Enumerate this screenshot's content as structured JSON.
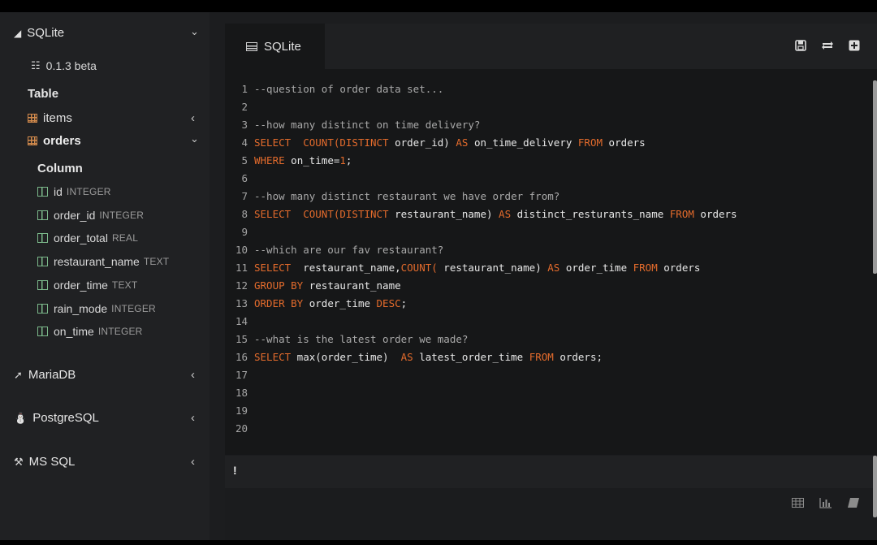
{
  "sidebar": {
    "sqlite": {
      "title": "SQLite",
      "version": "0.1.3 beta"
    },
    "table_heading": "Table",
    "tables": [
      {
        "name": "items"
      },
      {
        "name": "orders"
      }
    ],
    "column_heading": "Column",
    "columns": [
      {
        "name": "id",
        "type": "INTEGER"
      },
      {
        "name": "order_id",
        "type": "INTEGER"
      },
      {
        "name": "order_total",
        "type": "REAL"
      },
      {
        "name": "restaurant_name",
        "type": "TEXT"
      },
      {
        "name": "order_time",
        "type": "TEXT"
      },
      {
        "name": "rain_mode",
        "type": "INTEGER"
      },
      {
        "name": "on_time",
        "type": "INTEGER"
      }
    ],
    "other_dbs": [
      {
        "title": "MariaDB"
      },
      {
        "title": "PostgreSQL"
      },
      {
        "title": "MS SQL"
      }
    ]
  },
  "editor": {
    "tab_label": "SQLite",
    "lines": [
      {
        "n": "1",
        "tokens": [
          [
            "cm",
            "--question of order data set..."
          ]
        ]
      },
      {
        "n": "2",
        "tokens": []
      },
      {
        "n": "3",
        "tokens": [
          [
            "cm",
            "--how many distinct on time delivery?"
          ]
        ]
      },
      {
        "n": "4",
        "tokens": [
          [
            "kw",
            "SELECT"
          ],
          [
            "tx",
            "  "
          ],
          [
            "kw",
            "COUNT(DISTINCT"
          ],
          [
            "tx",
            " order_id) "
          ],
          [
            "kw",
            "AS"
          ],
          [
            "tx",
            " on_time_delivery "
          ],
          [
            "kw",
            "FROM"
          ],
          [
            "tx",
            " orders"
          ]
        ]
      },
      {
        "n": "5",
        "tokens": [
          [
            "kw",
            "WHERE"
          ],
          [
            "tx",
            " on_time="
          ],
          [
            "num",
            "1"
          ],
          [
            "tx",
            ";"
          ]
        ]
      },
      {
        "n": "6",
        "tokens": []
      },
      {
        "n": "7",
        "tokens": [
          [
            "cm",
            "--how many distinct restaurant we have order from?"
          ]
        ]
      },
      {
        "n": "8",
        "tokens": [
          [
            "kw",
            "SELECT"
          ],
          [
            "tx",
            "  "
          ],
          [
            "kw",
            "COUNT(DISTINCT"
          ],
          [
            "tx",
            " restaurant_name) "
          ],
          [
            "kw",
            "AS"
          ],
          [
            "tx",
            " distinct_resturants_name "
          ],
          [
            "kw",
            "FROM"
          ],
          [
            "tx",
            " orders"
          ]
        ]
      },
      {
        "n": "9",
        "tokens": []
      },
      {
        "n": "10",
        "tokens": [
          [
            "cm",
            "--which are our fav restaurant?"
          ]
        ]
      },
      {
        "n": "11",
        "tokens": [
          [
            "kw",
            "SELECT"
          ],
          [
            "tx",
            "  restaurant_name,"
          ],
          [
            "kw",
            "COUNT("
          ],
          [
            "tx",
            " restaurant_name) "
          ],
          [
            "kw",
            "AS"
          ],
          [
            "tx",
            " order_time "
          ],
          [
            "kw",
            "FROM"
          ],
          [
            "tx",
            " orders"
          ]
        ]
      },
      {
        "n": "12",
        "tokens": [
          [
            "kw",
            "GROUP BY"
          ],
          [
            "tx",
            " restaurant_name"
          ]
        ]
      },
      {
        "n": "13",
        "tokens": [
          [
            "kw",
            "ORDER BY"
          ],
          [
            "tx",
            " order_time "
          ],
          [
            "kw",
            "DESC"
          ],
          [
            "tx",
            ";"
          ]
        ]
      },
      {
        "n": "14",
        "tokens": []
      },
      {
        "n": "15",
        "tokens": [
          [
            "cm",
            "--what is the latest order we made?"
          ]
        ]
      },
      {
        "n": "16",
        "tokens": [
          [
            "kw",
            "SELECT"
          ],
          [
            "tx",
            " max(order_time)  "
          ],
          [
            "kw",
            "AS"
          ],
          [
            "tx",
            " latest_order_time "
          ],
          [
            "kw",
            "FROM"
          ],
          [
            "tx",
            " orders;"
          ]
        ]
      },
      {
        "n": "17",
        "tokens": []
      },
      {
        "n": "18",
        "tokens": []
      },
      {
        "n": "19",
        "tokens": []
      },
      {
        "n": "20",
        "tokens": []
      }
    ]
  },
  "result": {
    "marker": "!"
  },
  "colors": {
    "keyword": "#e36b2c",
    "comment": "#a9a9a9",
    "table_icon": "#d28a4c",
    "column_icon": "#7bb88a"
  },
  "icons": {
    "sqlite": "feather-icon",
    "version": "sitemap-icon",
    "mariadb": "seal-icon",
    "postgres": "elephant-icon",
    "mssql": "wrench-icon",
    "save": "save-icon",
    "refresh": "refresh-icon",
    "add": "plus-square-icon",
    "table_view": "table-icon",
    "chart_view": "bar-chart-icon",
    "text_view": "eraser-icon"
  }
}
